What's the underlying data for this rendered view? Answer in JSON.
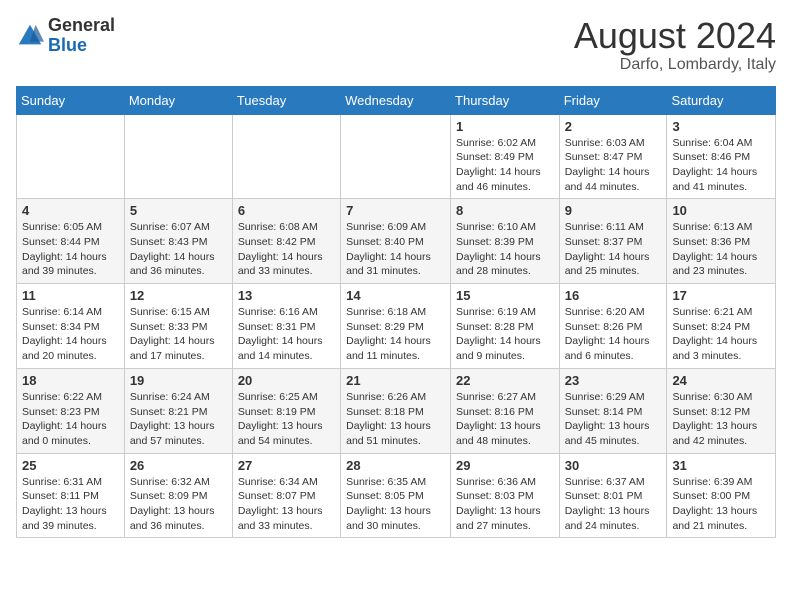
{
  "header": {
    "logo_general": "General",
    "logo_blue": "Blue",
    "month_year": "August 2024",
    "location": "Darfo, Lombardy, Italy"
  },
  "days_of_week": [
    "Sunday",
    "Monday",
    "Tuesday",
    "Wednesday",
    "Thursday",
    "Friday",
    "Saturday"
  ],
  "weeks": [
    [
      {
        "day": "",
        "info": ""
      },
      {
        "day": "",
        "info": ""
      },
      {
        "day": "",
        "info": ""
      },
      {
        "day": "",
        "info": ""
      },
      {
        "day": "1",
        "info": "Sunrise: 6:02 AM\nSunset: 8:49 PM\nDaylight: 14 hours and 46 minutes."
      },
      {
        "day": "2",
        "info": "Sunrise: 6:03 AM\nSunset: 8:47 PM\nDaylight: 14 hours and 44 minutes."
      },
      {
        "day": "3",
        "info": "Sunrise: 6:04 AM\nSunset: 8:46 PM\nDaylight: 14 hours and 41 minutes."
      }
    ],
    [
      {
        "day": "4",
        "info": "Sunrise: 6:05 AM\nSunset: 8:44 PM\nDaylight: 14 hours and 39 minutes."
      },
      {
        "day": "5",
        "info": "Sunrise: 6:07 AM\nSunset: 8:43 PM\nDaylight: 14 hours and 36 minutes."
      },
      {
        "day": "6",
        "info": "Sunrise: 6:08 AM\nSunset: 8:42 PM\nDaylight: 14 hours and 33 minutes."
      },
      {
        "day": "7",
        "info": "Sunrise: 6:09 AM\nSunset: 8:40 PM\nDaylight: 14 hours and 31 minutes."
      },
      {
        "day": "8",
        "info": "Sunrise: 6:10 AM\nSunset: 8:39 PM\nDaylight: 14 hours and 28 minutes."
      },
      {
        "day": "9",
        "info": "Sunrise: 6:11 AM\nSunset: 8:37 PM\nDaylight: 14 hours and 25 minutes."
      },
      {
        "day": "10",
        "info": "Sunrise: 6:13 AM\nSunset: 8:36 PM\nDaylight: 14 hours and 23 minutes."
      }
    ],
    [
      {
        "day": "11",
        "info": "Sunrise: 6:14 AM\nSunset: 8:34 PM\nDaylight: 14 hours and 20 minutes."
      },
      {
        "day": "12",
        "info": "Sunrise: 6:15 AM\nSunset: 8:33 PM\nDaylight: 14 hours and 17 minutes."
      },
      {
        "day": "13",
        "info": "Sunrise: 6:16 AM\nSunset: 8:31 PM\nDaylight: 14 hours and 14 minutes."
      },
      {
        "day": "14",
        "info": "Sunrise: 6:18 AM\nSunset: 8:29 PM\nDaylight: 14 hours and 11 minutes."
      },
      {
        "day": "15",
        "info": "Sunrise: 6:19 AM\nSunset: 8:28 PM\nDaylight: 14 hours and 9 minutes."
      },
      {
        "day": "16",
        "info": "Sunrise: 6:20 AM\nSunset: 8:26 PM\nDaylight: 14 hours and 6 minutes."
      },
      {
        "day": "17",
        "info": "Sunrise: 6:21 AM\nSunset: 8:24 PM\nDaylight: 14 hours and 3 minutes."
      }
    ],
    [
      {
        "day": "18",
        "info": "Sunrise: 6:22 AM\nSunset: 8:23 PM\nDaylight: 14 hours and 0 minutes."
      },
      {
        "day": "19",
        "info": "Sunrise: 6:24 AM\nSunset: 8:21 PM\nDaylight: 13 hours and 57 minutes."
      },
      {
        "day": "20",
        "info": "Sunrise: 6:25 AM\nSunset: 8:19 PM\nDaylight: 13 hours and 54 minutes."
      },
      {
        "day": "21",
        "info": "Sunrise: 6:26 AM\nSunset: 8:18 PM\nDaylight: 13 hours and 51 minutes."
      },
      {
        "day": "22",
        "info": "Sunrise: 6:27 AM\nSunset: 8:16 PM\nDaylight: 13 hours and 48 minutes."
      },
      {
        "day": "23",
        "info": "Sunrise: 6:29 AM\nSunset: 8:14 PM\nDaylight: 13 hours and 45 minutes."
      },
      {
        "day": "24",
        "info": "Sunrise: 6:30 AM\nSunset: 8:12 PM\nDaylight: 13 hours and 42 minutes."
      }
    ],
    [
      {
        "day": "25",
        "info": "Sunrise: 6:31 AM\nSunset: 8:11 PM\nDaylight: 13 hours and 39 minutes."
      },
      {
        "day": "26",
        "info": "Sunrise: 6:32 AM\nSunset: 8:09 PM\nDaylight: 13 hours and 36 minutes."
      },
      {
        "day": "27",
        "info": "Sunrise: 6:34 AM\nSunset: 8:07 PM\nDaylight: 13 hours and 33 minutes."
      },
      {
        "day": "28",
        "info": "Sunrise: 6:35 AM\nSunset: 8:05 PM\nDaylight: 13 hours and 30 minutes."
      },
      {
        "day": "29",
        "info": "Sunrise: 6:36 AM\nSunset: 8:03 PM\nDaylight: 13 hours and 27 minutes."
      },
      {
        "day": "30",
        "info": "Sunrise: 6:37 AM\nSunset: 8:01 PM\nDaylight: 13 hours and 24 minutes."
      },
      {
        "day": "31",
        "info": "Sunrise: 6:39 AM\nSunset: 8:00 PM\nDaylight: 13 hours and 21 minutes."
      }
    ]
  ]
}
